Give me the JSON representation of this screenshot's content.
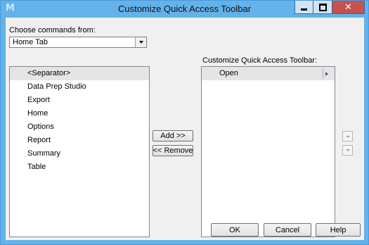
{
  "window": {
    "title": "Customize Quick Access Toolbar",
    "app_icon_glyph": "M",
    "accent_color": "#63b2ea",
    "close_color": "#c75050"
  },
  "left_panel": {
    "choose_label": "Choose commands from:",
    "dropdown_value": "Home Tab",
    "items": [
      "<Separator>",
      "Data Prep Studio",
      "Export",
      "Home",
      "Options",
      "Report",
      "Summary",
      "Table"
    ],
    "selected_index": 0
  },
  "right_panel": {
    "label": "Customize Quick Access Toolbar:",
    "items": [
      "Open"
    ]
  },
  "middle_buttons": {
    "add": "Add >>",
    "remove": "<< Remove"
  },
  "footer": {
    "ok": "OK",
    "cancel": "Cancel",
    "help": "Help"
  },
  "icons": {
    "minimize": "minimize-icon",
    "maximize": "maximize-icon",
    "close": "close-icon",
    "move_up": "move-up-icon",
    "move_down": "move-down-icon"
  }
}
